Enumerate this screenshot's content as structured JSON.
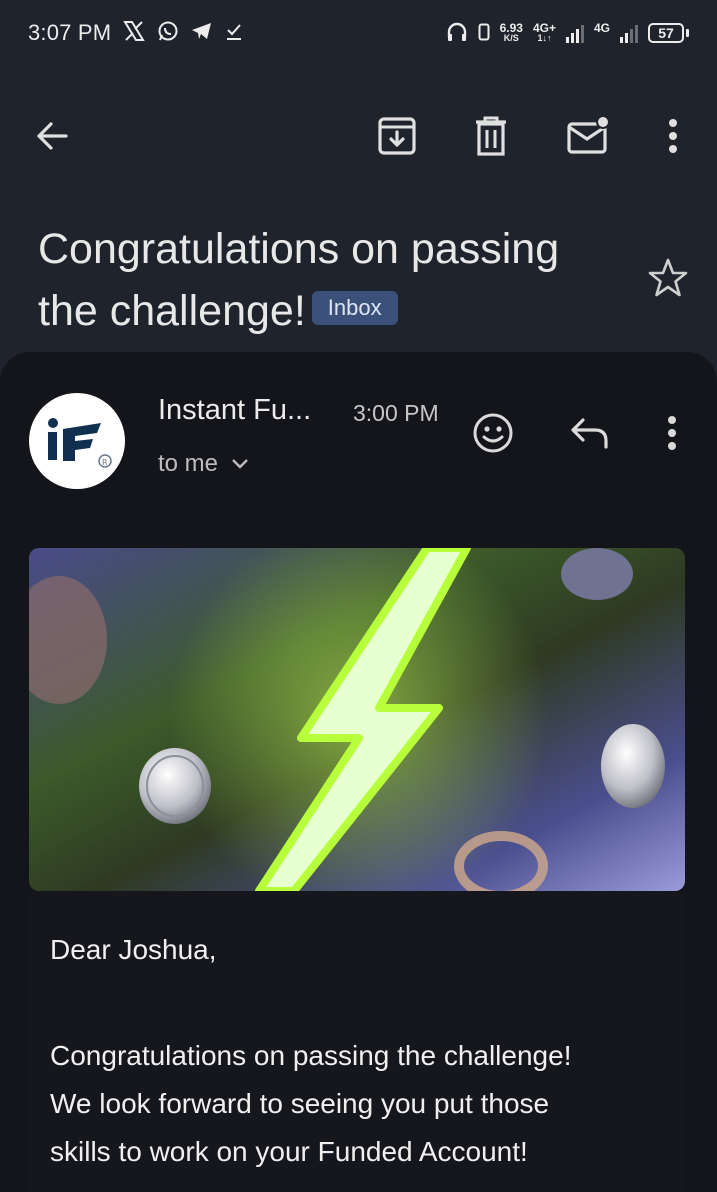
{
  "status_bar": {
    "time": "3:07 PM",
    "net_speed": "6.93",
    "net_unit": "K/S",
    "net1": "4G+",
    "net2": "4G",
    "battery": "57"
  },
  "email": {
    "subject_line1": "Congratulations on passing",
    "subject_line2": "the challenge!",
    "label": "Inbox",
    "sender": "Instant Fu...",
    "time": "3:00 PM",
    "recipient": "to me",
    "greeting": "Dear Joshua,",
    "body_line1": "Congratulations on passing the challenge!",
    "body_line2": "We look forward to seeing you put those",
    "body_line3": "skills to work on your Funded Account!"
  },
  "colors": {
    "background": "#1f232b",
    "card": "#13151a",
    "badge": "#3c5179",
    "accent_lightning": "#b6ff3a"
  },
  "icons": [
    "back-arrow-icon",
    "archive-icon",
    "delete-icon",
    "mark-unread-icon",
    "more-vert-icon",
    "star-icon",
    "emoji-icon",
    "reply-icon",
    "chevron-down-icon"
  ]
}
